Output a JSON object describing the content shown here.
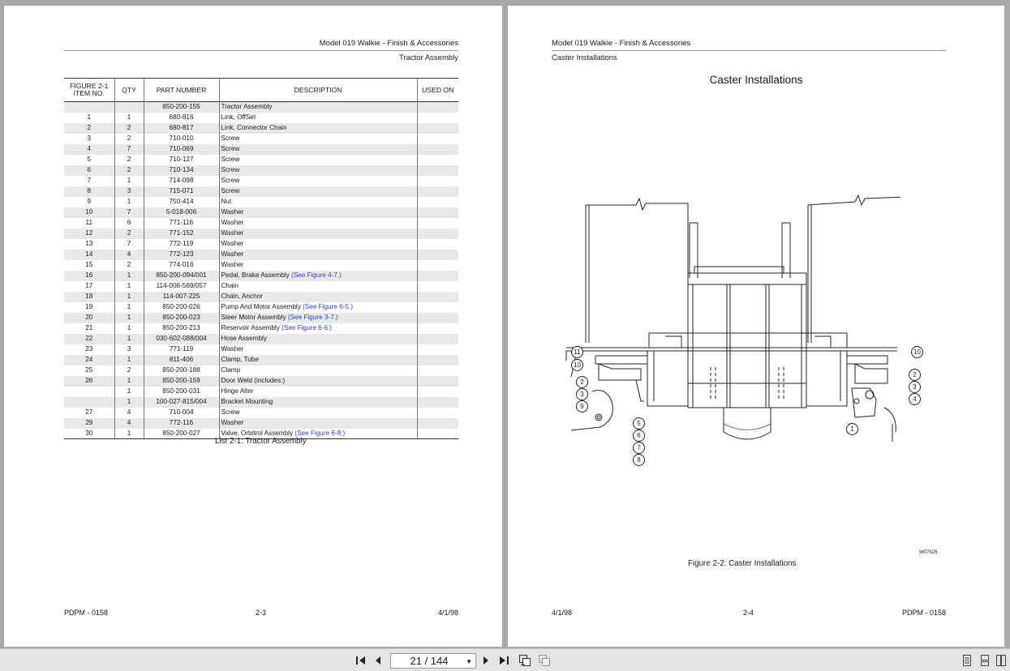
{
  "left_page": {
    "header": {
      "model": "Model 019 Walkie - Finish & Accessories",
      "section": "Tractor Assembly"
    },
    "table": {
      "headers": {
        "item_line1": "FIGURE 2-1",
        "item_line2": "ITEM NO.",
        "qty": "QTY",
        "part": "PART NUMBER",
        "desc": "DESCRIPTION",
        "used": "USED ON"
      },
      "rows": [
        {
          "item": "",
          "qty": "",
          "part": "850-200-155",
          "desc": "Tractor Assembly",
          "ref": ""
        },
        {
          "item": "1",
          "qty": "1",
          "part": "680-816",
          "desc": "Link, OffSet",
          "ref": ""
        },
        {
          "item": "2",
          "qty": "2",
          "part": "680-817",
          "desc": "Link, Connector Chain",
          "ref": ""
        },
        {
          "item": "3",
          "qty": "2",
          "part": "710-010",
          "desc": "Screw",
          "ref": ""
        },
        {
          "item": "4",
          "qty": "7",
          "part": "710-069",
          "desc": "Screw",
          "ref": ""
        },
        {
          "item": "5",
          "qty": "2",
          "part": "710-127",
          "desc": "Screw",
          "ref": ""
        },
        {
          "item": "6",
          "qty": "2",
          "part": "710-134",
          "desc": "Screw",
          "ref": ""
        },
        {
          "item": "7",
          "qty": "1",
          "part": "714-098",
          "desc": "Screw",
          "ref": ""
        },
        {
          "item": "8",
          "qty": "3",
          "part": "715-071",
          "desc": "Screw",
          "ref": ""
        },
        {
          "item": "9",
          "qty": "1",
          "part": "750-414",
          "desc": "Nut",
          "ref": ""
        },
        {
          "item": "10",
          "qty": "7",
          "part": "5-018-006",
          "desc": "Washer",
          "ref": ""
        },
        {
          "item": "11",
          "qty": "6",
          "part": "771-116",
          "desc": "Washer",
          "ref": ""
        },
        {
          "item": "12",
          "qty": "2",
          "part": "771-152",
          "desc": "Washer",
          "ref": ""
        },
        {
          "item": "13",
          "qty": "7",
          "part": "772-119",
          "desc": "Washer",
          "ref": ""
        },
        {
          "item": "14",
          "qty": "4",
          "part": "772-123",
          "desc": "Washer",
          "ref": ""
        },
        {
          "item": "15",
          "qty": "2",
          "part": "774-016",
          "desc": "Washer",
          "ref": ""
        },
        {
          "item": "16",
          "qty": "1",
          "part": "850-200-094/001",
          "desc": "Pedal, Brake Assembly",
          "ref": "(See Figure 4-7.)"
        },
        {
          "item": "17",
          "qty": "1",
          "part": "114-006-569/057",
          "desc": "Chain",
          "ref": ""
        },
        {
          "item": "18",
          "qty": "1",
          "part": "114-007-225",
          "desc": "Chain, Anchor",
          "ref": ""
        },
        {
          "item": "19",
          "qty": "1",
          "part": "850-200-026",
          "desc": "Pump And Motor Assembly",
          "ref": "(See Figure 6-5.)"
        },
        {
          "item": "20",
          "qty": "1",
          "part": "850-200-023",
          "desc": "Steer Motor Assembly",
          "ref": "(See Figure 3-7.)"
        },
        {
          "item": "21",
          "qty": "1",
          "part": "850-200-213",
          "desc": "Reservoir Assembly",
          "ref": "(See Figure 6-6.)"
        },
        {
          "item": "22",
          "qty": "1",
          "part": "030-602-088/004",
          "desc": "Hose Assembly",
          "ref": ""
        },
        {
          "item": "23",
          "qty": "3",
          "part": "771-119",
          "desc": "Washer",
          "ref": ""
        },
        {
          "item": "24",
          "qty": "1",
          "part": "811-406",
          "desc": "Clamp, Tube",
          "ref": ""
        },
        {
          "item": "25",
          "qty": "2",
          "part": "850-200-188",
          "desc": "Clamp",
          "ref": ""
        },
        {
          "item": "26",
          "qty": "1",
          "part": "850-200-159",
          "desc": "Door Weld (includes:)",
          "ref": ""
        },
        {
          "item": "",
          "qty": "1",
          "part": "850-200-031",
          "desc": "Hinge Alter",
          "ref": "",
          "indent": true
        },
        {
          "item": "",
          "qty": "1",
          "part": "100-027-815/004",
          "desc": "Bracket Mounting",
          "ref": "",
          "indent": true
        },
        {
          "item": "27",
          "qty": "4",
          "part": "710-004",
          "desc": "Screw",
          "ref": ""
        },
        {
          "item": "29",
          "qty": "4",
          "part": "772-116",
          "desc": "Washer",
          "ref": ""
        },
        {
          "item": "30",
          "qty": "1",
          "part": "850-200-027",
          "desc": "Valve, Orbitrol Assembly",
          "ref": "(See Figure 6-8.)"
        }
      ]
    },
    "caption": "List 2-1:  Tractor Assembly",
    "footer": {
      "doc": "PDPM - 0158",
      "page": "2-3",
      "date": "4/1/98"
    }
  },
  "right_page": {
    "header": {
      "model": "Model 019 Walkie - Finish & Accessories",
      "section": "Caster Installations"
    },
    "title": "Caster Installations",
    "figure_code": "W07625",
    "callouts_left": [
      "11",
      "10",
      "2",
      "3",
      "9"
    ],
    "callouts_bottom": [
      "5",
      "6",
      "7",
      "8"
    ],
    "callouts_right": [
      "10",
      "2",
      "3",
      "4",
      "1"
    ],
    "caption": "Figure 2-2:  Caster Installations",
    "footer": {
      "date": "4/1/98",
      "page": "2-4",
      "doc": "PDPM - 0158"
    }
  },
  "toolbar": {
    "page_indicator": "21 / 144",
    "icons": [
      "first-page-icon",
      "prev-page-icon",
      "next-page-icon",
      "last-page-icon",
      "page-view-icon",
      "two-page-view-icon",
      "single-page-icon",
      "continuous-page-icon",
      "facing-pages-icon"
    ]
  }
}
